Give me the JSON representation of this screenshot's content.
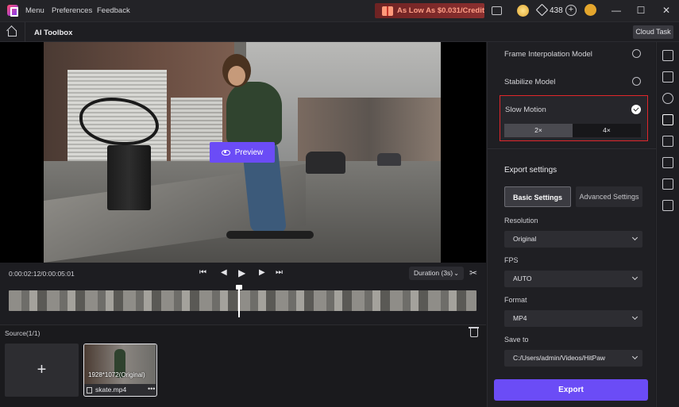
{
  "titlebar": {
    "menus": [
      "Menu",
      "Preferences",
      "Feedback"
    ],
    "promo": "As Low As $0.031/Credit",
    "credits": "438",
    "icons": [
      "app-logo-icon",
      "chat-icon",
      "coin-icon",
      "gem-icon",
      "plus-icon",
      "avatar-icon"
    ],
    "window_controls": [
      "—",
      "☐",
      "✕"
    ]
  },
  "subbar": {
    "title": "AI Toolbox",
    "cloud_task": "Cloud Task"
  },
  "preview": {
    "button": "Preview"
  },
  "controls": {
    "timecode": "0:00:02:12/0:00:05:01",
    "duration": "Duration (3s)",
    "playhead_fraction": 0.49
  },
  "source": {
    "title": "Source(1/1)",
    "add_label": "+",
    "clip": {
      "resolution": "1928*1072(Original)",
      "name": "skate.mp4",
      "more": "•••"
    }
  },
  "settings": {
    "models": [
      {
        "label": "Frame Interpolation Model",
        "selected": false
      },
      {
        "label": "Stabilize Model",
        "selected": false
      }
    ],
    "slow_motion": {
      "label": "Slow Motion",
      "selected": true,
      "options": [
        "2×",
        "4×"
      ],
      "active_option": "2×"
    },
    "export_title": "Export settings",
    "tabs": {
      "basic": "Basic Settings",
      "advanced": "Advanced Settings"
    },
    "fields": [
      {
        "label": "Resolution",
        "value": "Original"
      },
      {
        "label": "FPS",
        "value": "AUTO"
      },
      {
        "label": "Format",
        "value": "MP4"
      },
      {
        "label": "Save to",
        "value": "C:/Users/admin/Videos/HitPaw"
      }
    ],
    "export_button": "Export"
  },
  "rail": {
    "icons": [
      "video-enhance-icon",
      "edit-icon",
      "sync-icon",
      "toolbox-icon",
      "pen-icon",
      "eraser-icon",
      "crop-icon",
      "player-icon"
    ],
    "active_icon": "toolbox-icon"
  },
  "colors": {
    "accent": "#6b4cf6",
    "highlight_border": "#e0262b",
    "promo_text": "#ff9e86"
  }
}
